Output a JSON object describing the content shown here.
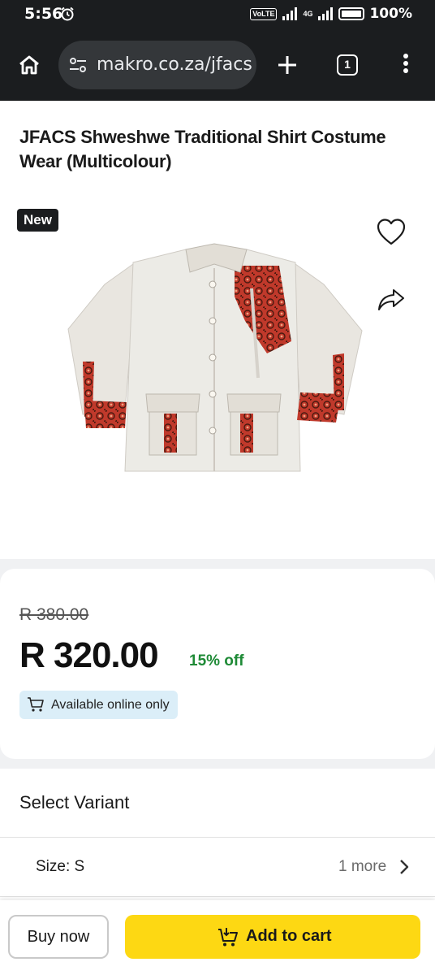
{
  "status_bar": {
    "time": "5:56",
    "network_badge": "VoLTE",
    "network_type": "4G",
    "battery": "100%"
  },
  "browser": {
    "url": "makro.co.za/jfacs",
    "tab_count": "1",
    "icons": {
      "home": "home-icon",
      "site_settings": "tune-icon",
      "new_tab": "plus-icon",
      "menu": "more-vert-icon"
    }
  },
  "product": {
    "title": "JFACS Shweshwe Traditional Shirt Costume Wear (Multicolour)",
    "badge": "New",
    "old_price": "R 380.00",
    "price": "R 320.00",
    "discount": "15% off",
    "availability": "Available online only"
  },
  "variant": {
    "heading": "Select Variant",
    "size_label": "Size: S",
    "more_label": "1 more"
  },
  "actions": {
    "buy_now": "Buy now",
    "add_to_cart": "Add to cart"
  },
  "colors": {
    "accent": "#fdd813",
    "discount": "#1e8a36",
    "badge_bg": "#1b1d1f",
    "online_badge_bg": "#dbeef8"
  }
}
